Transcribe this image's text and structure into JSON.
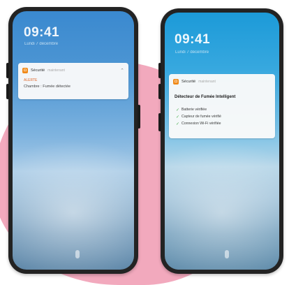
{
  "left_phone": {
    "time": "09:41",
    "date": "Lundi 7 décembre",
    "notification": {
      "app_name": "Sécurité",
      "timestamp": "maintenant",
      "alert_label": "ALERTE",
      "alert_text": "Chambre : Fumée détectée"
    }
  },
  "right_phone": {
    "time": "09:41",
    "date": "Lundi 7 décembre",
    "notification": {
      "app_name": "Sécurité",
      "timestamp": "maintenant",
      "title": "Détecteur de Fumée Intelligent",
      "checks": [
        "Batterie vérifiée",
        "Capteur de fumée vérifié",
        "Connexion Wi-Fi vérifiée"
      ]
    }
  },
  "colors": {
    "accent_pink": "#f2a9bd",
    "app_icon": "#f08a1a",
    "alert": "#e0682a",
    "check": "#4caf50"
  },
  "icons": {
    "app": "shield-icon",
    "check": "check-icon",
    "expand": "chevron-up-icon"
  }
}
